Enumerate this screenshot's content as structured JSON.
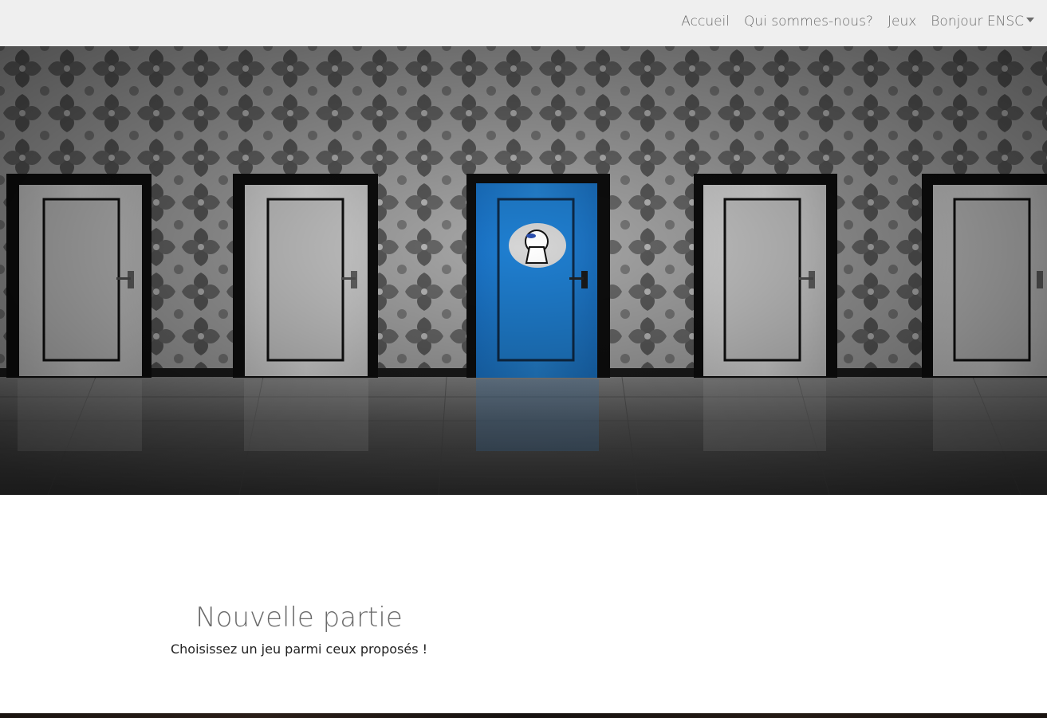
{
  "navbar": {
    "links": [
      {
        "label": "Accueil"
      },
      {
        "label": "Qui sommes-nous?"
      },
      {
        "label": "Jeux"
      }
    ],
    "user_menu": {
      "label": "Bonjour ENSC"
    }
  },
  "hero": {
    "image": "row-of-doors-with-blue-door",
    "accent_color": "#1f7fd1"
  },
  "intro": {
    "title": "Nouvelle partie",
    "subtitle": "Choisissez un jeu parmi ceux proposés !"
  }
}
